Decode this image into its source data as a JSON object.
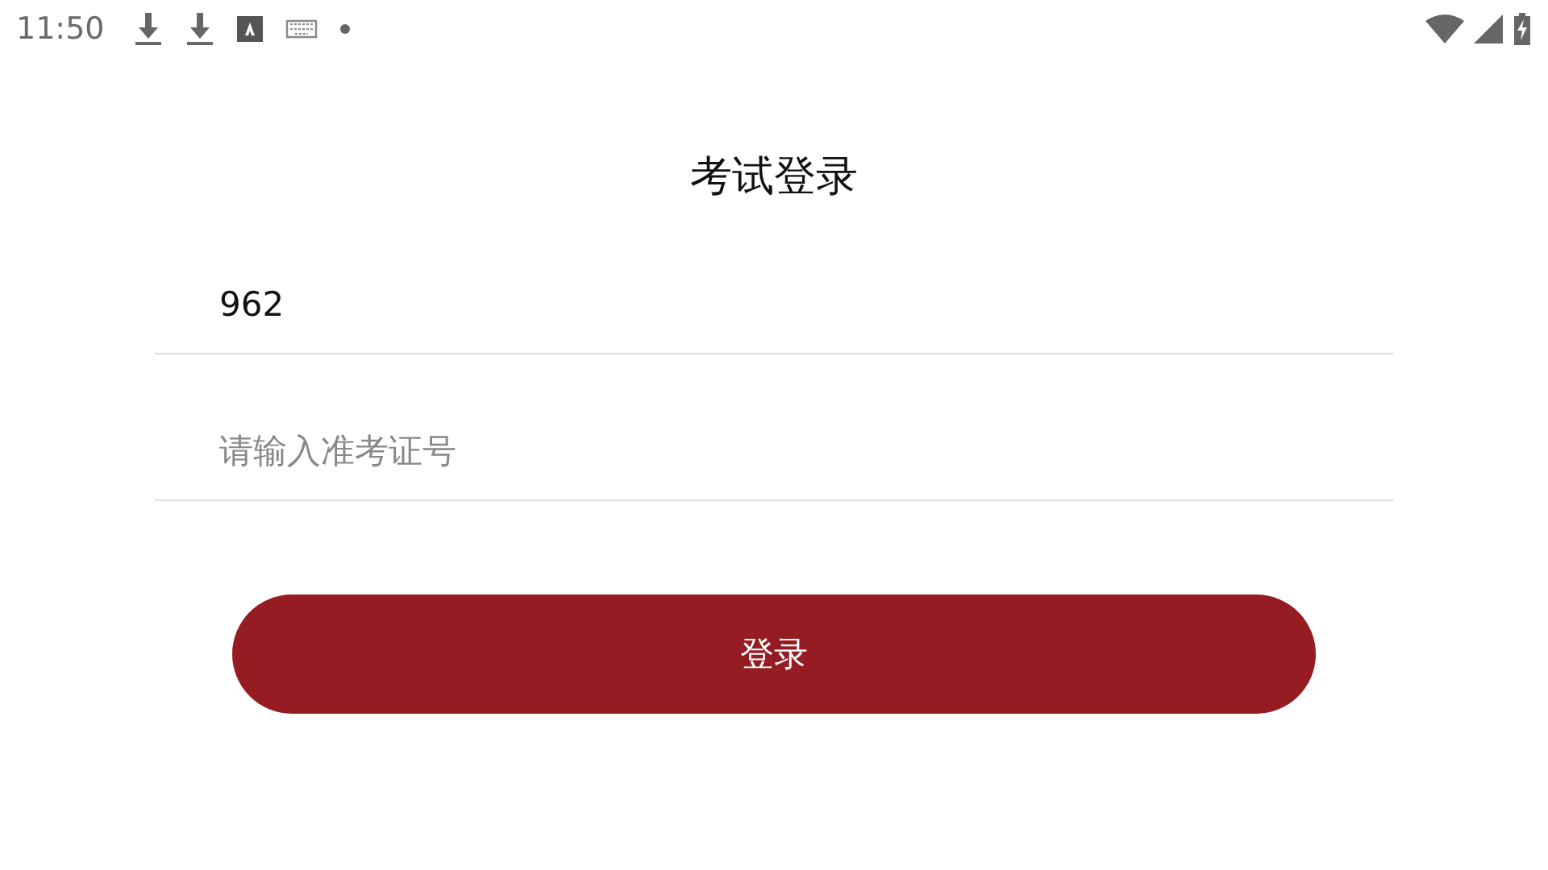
{
  "status_bar": {
    "time": "11:50"
  },
  "title": "考试登录",
  "fields": [
    {
      "value": "962"
    },
    {
      "placeholder": "请输入准考证号"
    }
  ],
  "login_button": "登录"
}
